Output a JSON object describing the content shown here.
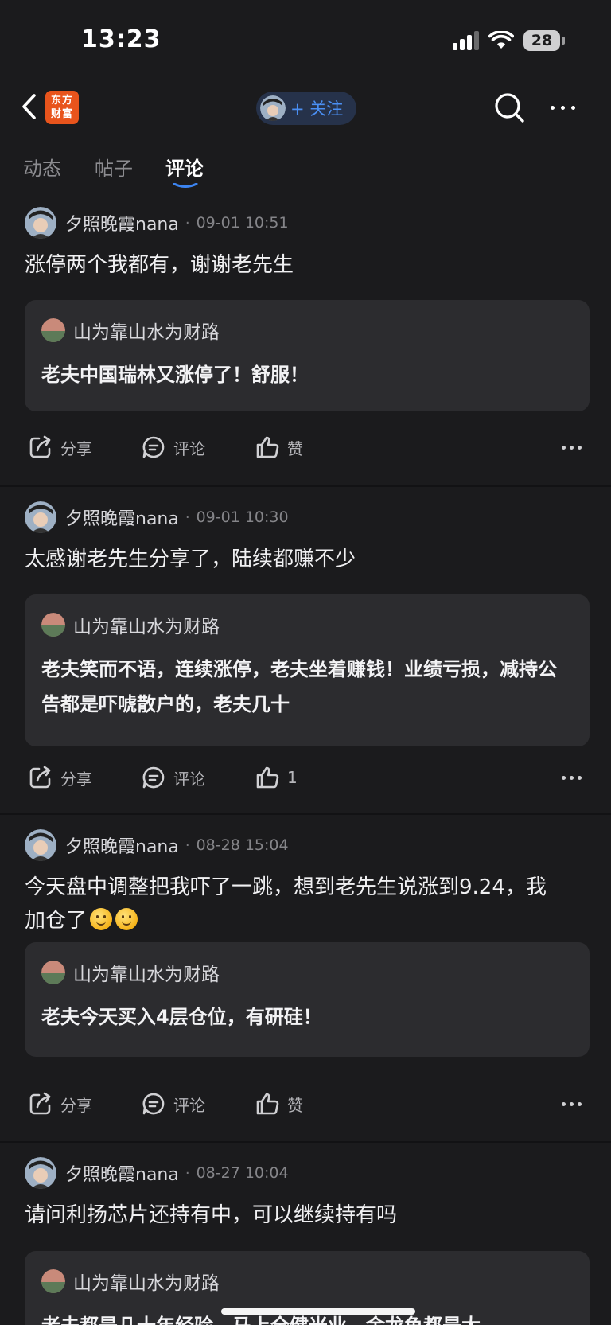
{
  "status_bar": {
    "time": "13:23",
    "battery": "28"
  },
  "nav": {
    "logo_line1": "东方",
    "logo_line2": "财富",
    "follow_label": "+ 关注",
    "colors": {
      "accent": "#4a8ff3",
      "logo_bg": "#e8541c"
    }
  },
  "tabs": [
    {
      "label": "动态",
      "active": false
    },
    {
      "label": "帖子",
      "active": false
    },
    {
      "label": "评论",
      "active": true
    }
  ],
  "posts": [
    {
      "author": "夕照晚霞nana",
      "time": "09-01 10:51",
      "text": "涨停两个我都有，谢谢老先生",
      "quote": {
        "author": "山为靠山水为财路",
        "text": "老夫中国瑞林又涨停了！舒服！"
      },
      "actions": {
        "share": "分享",
        "comment": "评论",
        "like": "赞"
      }
    },
    {
      "author": "夕照晚霞nana",
      "time": "09-01 10:30",
      "text": "太感谢老先生分享了，陆续都赚不少",
      "quote": {
        "author": "山为靠山水为财路",
        "text": "老夫笑而不语，连续涨停，老夫坐着赚钱！业绩亏损，减持公告都是吓唬散户的，老夫几十"
      },
      "actions": {
        "share": "分享",
        "comment": "评论",
        "like": "1"
      }
    },
    {
      "author": "夕照晚霞nana",
      "time": "08-28 15:04",
      "text": "今天盘中调整把我吓了一跳，想到老先生说涨到9.24，我加仓了",
      "emoji": [
        "smile-emoji",
        "smile-emoji"
      ],
      "quote": {
        "author": "山为靠山水为财路",
        "text": "老夫今天买入4层仓位，有研硅！"
      },
      "actions": {
        "share": "分享",
        "comment": "评论",
        "like": "赞"
      }
    },
    {
      "author": "夕照晚霞nana",
      "time": "08-27 10:04",
      "text": "请问利扬芯片还持有中，可以继续持有吗",
      "quote": {
        "author": "山为靠山水为财路",
        "text": "老夫都是几十年经验，马上全健米业，金龙鱼都是大"
      }
    }
  ]
}
